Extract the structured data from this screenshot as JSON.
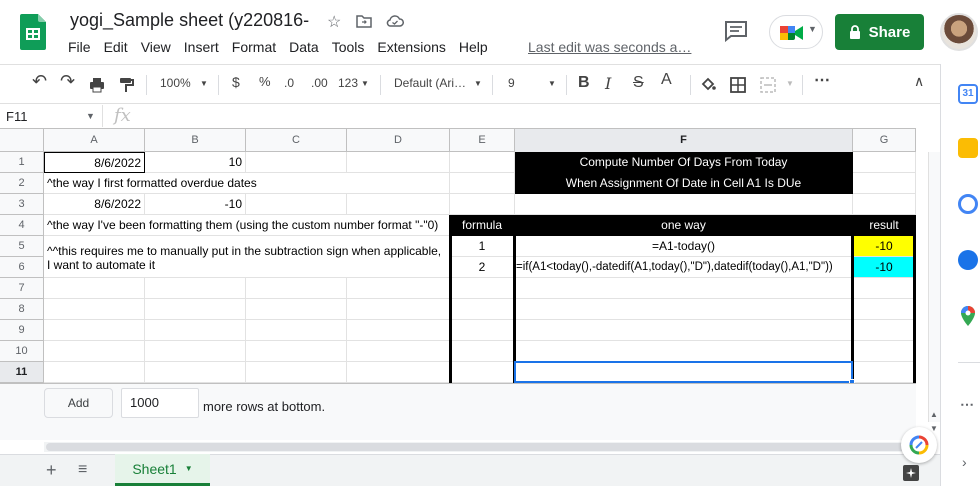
{
  "header": {
    "title": "yogi_Sample sheet (y220816-",
    "menu": [
      "File",
      "Edit",
      "View",
      "Insert",
      "Format",
      "Data",
      "Tools",
      "Extensions",
      "Help"
    ],
    "last_edit": "Last edit was seconds a…",
    "share_label": "Share"
  },
  "toolbar": {
    "zoom": "100%",
    "currency": "$",
    "percent": "%",
    "dec_decrease": ".0",
    "dec_increase": ".00",
    "format_more": "123",
    "font": "Default (Ari…",
    "font_size": "9"
  },
  "formula_bar": {
    "cell_ref": "F11",
    "fx": "fx",
    "value": ""
  },
  "columns": [
    "A",
    "B",
    "C",
    "D",
    "E",
    "F",
    "G"
  ],
  "rows": [
    "1",
    "2",
    "3",
    "4",
    "5",
    "6",
    "7",
    "8",
    "9",
    "10",
    "11"
  ],
  "cells": {
    "A1": "8/6/2022",
    "B1": "10",
    "F1": "Compute Number Of Days From Today",
    "A2": "^the way I first formatted overdue dates",
    "F2": "When Assignment Of Date in Cell A1 Is DUe",
    "A3": "8/6/2022",
    "B3": "-10",
    "A4": "^the way I've been formatting them (using the custom number format \"-\"0)",
    "E4": "formula",
    "F4": "one way",
    "G4": "result",
    "A5": "^^this requires me to manually put in the subtraction sign when applicable, I want to automate it",
    "E5": "1",
    "F5": "=A1-today()",
    "G5": "-10",
    "E6": "2",
    "F6": "=if(A1<today(),-datedif(A1,today(),\"D\"),datedif(today(),A1,\"D\"))",
    "G6": "-10"
  },
  "add_rows": {
    "button_label": "Add",
    "count": "1000",
    "suffix": "more rows at bottom."
  },
  "sheet_tab": {
    "name": "Sheet1"
  },
  "colors": {
    "share_green": "#188038",
    "black_fill": "#000000",
    "yellow_fill": "#ffff00",
    "cyan_fill": "#00ffff",
    "selection_blue": "#1a73e8"
  }
}
